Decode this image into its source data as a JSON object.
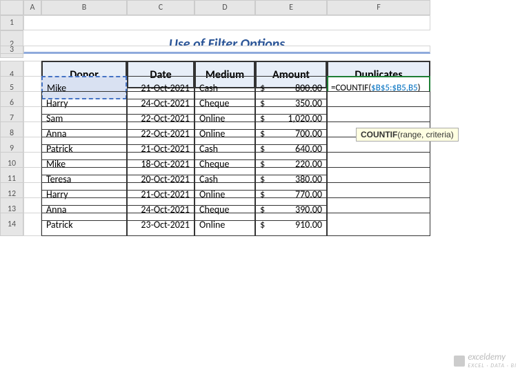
{
  "columns": [
    "A",
    "B",
    "C",
    "D",
    "E",
    "F"
  ],
  "rows": [
    "1",
    "2",
    "3",
    "4",
    "5",
    "6",
    "7",
    "8",
    "9",
    "10",
    "11",
    "12",
    "13",
    "14"
  ],
  "title": "Use of Filter Options",
  "headers": {
    "donor": "Donor",
    "date": "Date",
    "medium": "Medium",
    "amount": "Amount",
    "duplicates": "Duplicates"
  },
  "data": [
    {
      "donor": "Mike",
      "date": "21-Oct-2021",
      "medium": "Cash",
      "amount": "800.00"
    },
    {
      "donor": "Harry",
      "date": "24-Oct-2021",
      "medium": "Cheque",
      "amount": "350.00"
    },
    {
      "donor": "Sam",
      "date": "22-Oct-2021",
      "medium": "Online",
      "amount": "1,020.00"
    },
    {
      "donor": "Anna",
      "date": "22-Oct-2021",
      "medium": "Online",
      "amount": "700.00"
    },
    {
      "donor": "Patrick",
      "date": "21-Oct-2021",
      "medium": "Cash",
      "amount": "640.00"
    },
    {
      "donor": "Mike",
      "date": "18-Oct-2021",
      "medium": "Cheque",
      "amount": "220.00"
    },
    {
      "donor": "Teresa",
      "date": "20-Oct-2021",
      "medium": "Cash",
      "amount": "380.00"
    },
    {
      "donor": "Harry",
      "date": "21-Oct-2021",
      "medium": "Online",
      "amount": "770.00"
    },
    {
      "donor": "Anna",
      "date": "24-Oct-2021",
      "medium": "Cheque",
      "amount": "390.00"
    },
    {
      "donor": "Patrick",
      "date": "23-Oct-2021",
      "medium": "Online",
      "amount": "910.00"
    }
  ],
  "formula": {
    "prefix": "=COUNTIF(",
    "ref": "$B$5:$B5,B5",
    "suffix": ")"
  },
  "tooltip": {
    "fn": "COUNTIF",
    "sig": "(range, criteria)"
  },
  "currency": "$",
  "watermark": {
    "name": "exceldemy",
    "sub": "EXCEL · DATA · BI"
  }
}
